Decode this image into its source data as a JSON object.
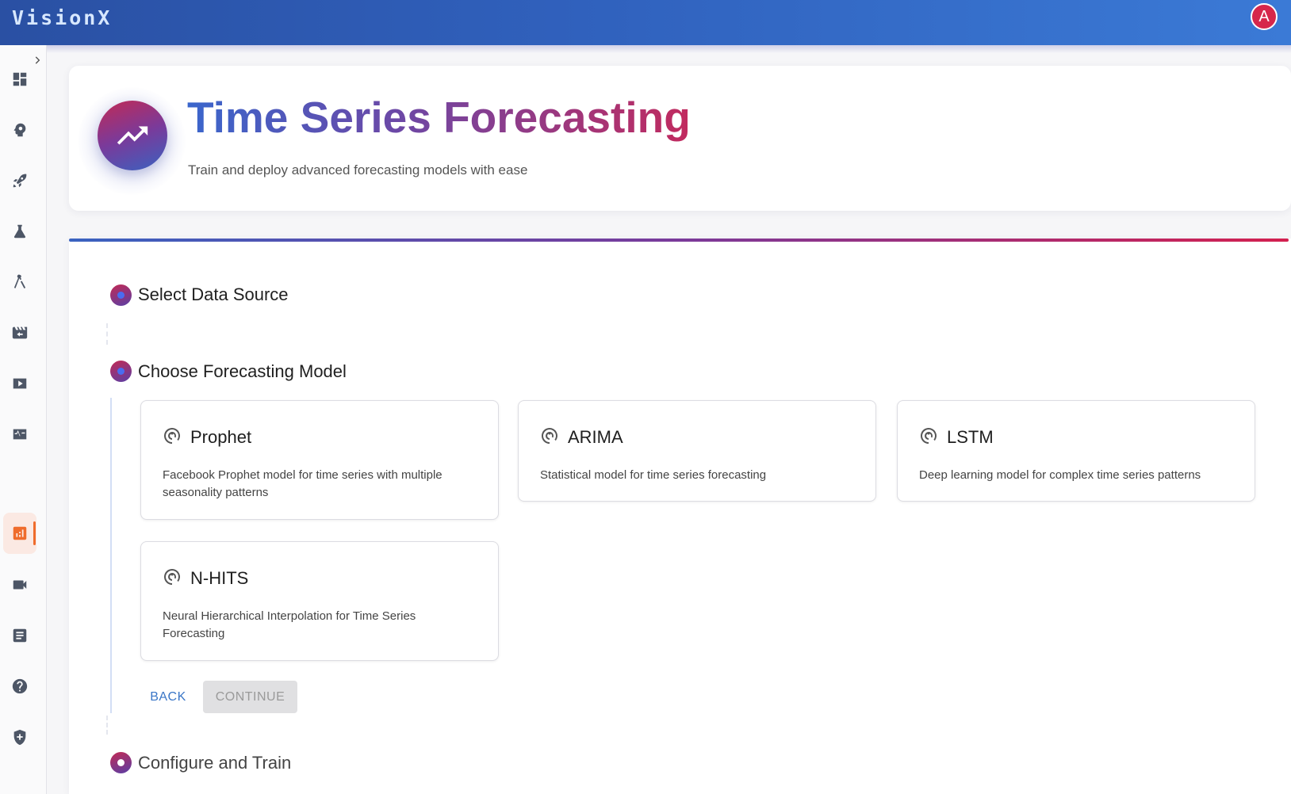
{
  "app": {
    "brand": "VisionX",
    "user_initial": "A"
  },
  "sidebar": {
    "items": [
      {
        "icon": "dashboard-icon"
      },
      {
        "icon": "brain-icon"
      },
      {
        "icon": "rocket-icon"
      },
      {
        "icon": "flask-icon"
      },
      {
        "icon": "compass-icon"
      },
      {
        "icon": "movie-icon"
      },
      {
        "icon": "play-icon"
      },
      {
        "icon": "monitor-heart-icon"
      },
      {
        "icon": "analytics-icon",
        "active": true
      },
      {
        "icon": "videocam-icon"
      },
      {
        "icon": "document-icon"
      },
      {
        "icon": "help-icon"
      },
      {
        "icon": "shield-icon"
      }
    ],
    "active_color": "#ef6c2c"
  },
  "header": {
    "icon": "trending-up-icon",
    "title": "Time Series Forecasting",
    "subtitle": "Train and deploy advanced forecasting models with ease"
  },
  "stepper": {
    "steps": [
      {
        "label": "Select Data Source"
      },
      {
        "label": "Choose Forecasting Model"
      },
      {
        "label": "Configure and Train"
      }
    ],
    "models": [
      {
        "name": "Prophet",
        "description": "Facebook Prophet model for time series with multiple seasonality patterns"
      },
      {
        "name": "ARIMA",
        "description": "Statistical model for time series forecasting"
      },
      {
        "name": "LSTM",
        "description": "Deep learning model for complex time series patterns"
      },
      {
        "name": "N-HITS",
        "description": "Neural Hierarchical Interpolation for Time Series Forecasting"
      }
    ],
    "buttons": {
      "back": "BACK",
      "continue": "CONTINUE"
    }
  },
  "colors": {
    "topbar_start": "#2a50a3",
    "topbar_end": "#3b7ad6",
    "accent_blue": "#3a66cc",
    "accent_magenta": "#c22a5e",
    "avatar": "#d6274b",
    "link": "#3a76c7"
  }
}
